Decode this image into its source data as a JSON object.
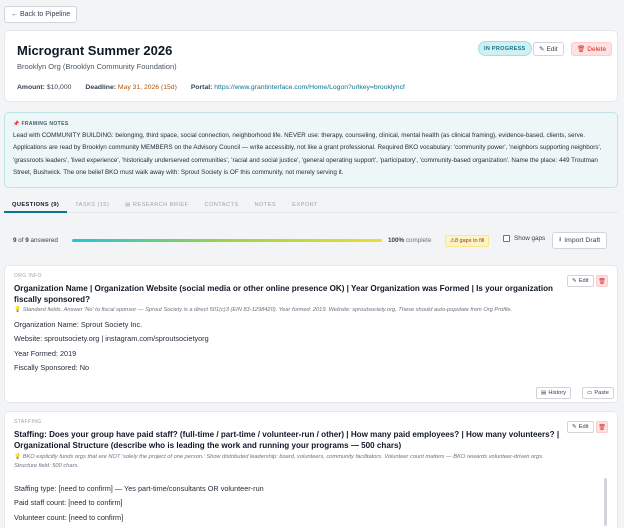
{
  "back": {
    "label": "← Back to Pipeline"
  },
  "header": {
    "title": "Microgrant Summer 2026",
    "org": "Brooklyn Org (Brooklyn Community Foundation)",
    "status": "IN PROGRESS",
    "edit_label": "Edit",
    "delete_label": "Delete",
    "amount_label": "Amount:",
    "amount_value": "$10,000",
    "deadline_label": "Deadline:",
    "deadline_value": "May 31, 2026 (15d)",
    "portal_label": "Portal:",
    "portal_value": "https://www.grantinterface.com/Home/Logon?urlkey=brooklyncf"
  },
  "framing": {
    "title": "FRAMING NOTES",
    "body": "Lead with COMMUNITY BUILDING: belonging, third space, social connection, neighborhood life. NEVER use: therapy, counseling, clinical, mental health (as clinical framing), evidence-based, clients, serve. Applications are read by Brooklyn community MEMBERS on the Advisory Council — write accessibly, not like a grant professional. Required BKO vocabulary: 'community power', 'neighbors supporting neighbors', 'grassroots leaders', 'lived experience', 'historically underserved communities', 'racial and social justice', 'general operating support', 'participatory', 'community-based organization'. Name the place: 449 Troutman Street, Bushwick. The one belief BKO must walk away with: Sprout Society is OF this community, not merely serving it."
  },
  "tabs": [
    {
      "label": "QUESTIONS (9)",
      "active": true
    },
    {
      "label": "TASKS (15)"
    },
    {
      "label": "RESEARCH BRIEF",
      "icon": "document-icon"
    },
    {
      "label": "CONTACTS"
    },
    {
      "label": "NOTES"
    },
    {
      "label": "EXPORT"
    }
  ],
  "progress": {
    "answered": "9",
    "total": "9",
    "answered_text": "answered",
    "of_text": "of",
    "percent_label": "100%",
    "complete_text": "complete",
    "percent_value": 100,
    "gaps_label": "8 gaps to fill",
    "show_gaps_label": "Show gaps",
    "import_label": "Import Draft"
  },
  "questions": [
    {
      "category": "ORG INFO",
      "text": "Organization Name | Organization Website (social media or other online presence OK) | Year Organization was Formed | Is your organization fiscally sponsored?",
      "hint": "Standard fields. Answer 'No' to fiscal sponsor — Sprout Society is a direct 501(c)3 (EIN 83-1298420). Year formed: 2019. Website: sproutsociety.org. These should auto-populate from Org Profile.",
      "answer": [
        "Organization Name: Sprout Society Inc.",
        "Website: sproutsociety.org | instagram.com/sproutsocietyorg",
        "Year Formed: 2019",
        "Fiscally Sponsored: No"
      ],
      "edit_label": "Edit",
      "history_label": "History",
      "paste_label": "Paste"
    },
    {
      "category": "STAFFING",
      "text": "Staffing: Does your group have paid staff? (full-time / part-time / volunteer-run / other) | How many paid employees? | How many volunteers? | Organizational Structure (describe who is leading the work and running your programs — 500 chars)",
      "hint": "BKO explicitly funds orgs that are NOT 'solely the project of one person.' Show distributed leadership: board, volunteers, community facilitators. Volunteer count matters — BKO rewards volunteer-driven orgs. Structure field: 500 chars.",
      "answer": [
        "Staffing type: [need to confirm] — Yes part-time/consultants OR volunteer-run",
        "Paid staff count: [need to confirm]",
        "Volunteer count: [need to confirm]"
      ],
      "edit_label": "Edit"
    }
  ]
}
